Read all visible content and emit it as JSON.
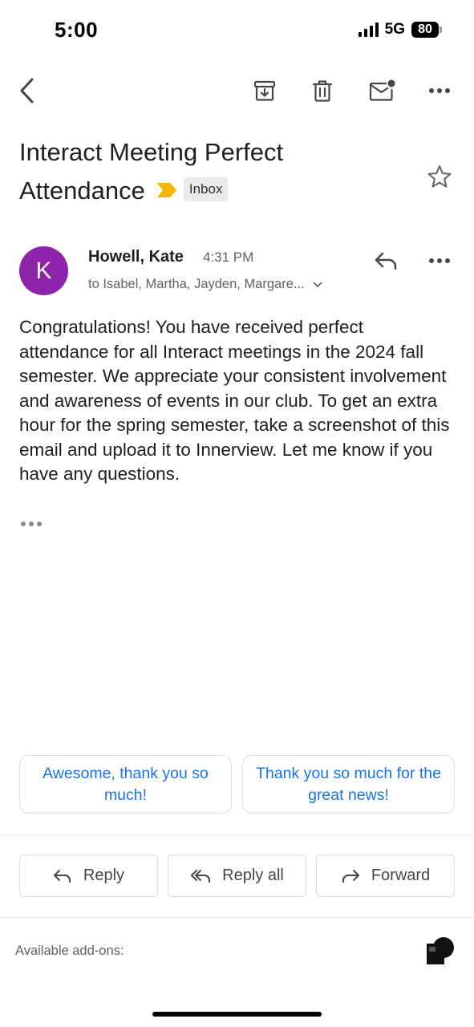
{
  "status_bar": {
    "time": "5:00",
    "network": "5G",
    "battery": "80"
  },
  "toolbar": {
    "icons": [
      "back-icon",
      "archive-icon",
      "trash-icon",
      "mark-unread-icon",
      "more-icon"
    ]
  },
  "email": {
    "subject": "Interact Meeting Perfect Attendance",
    "label": "Inbox",
    "importance_color": "#f4b400",
    "sender": {
      "initial": "K",
      "name": "Howell, Kate",
      "time": "4:31 PM",
      "recipients": "to Isabel, Martha, Jayden, Margare...",
      "avatar_color": "#8e24aa"
    },
    "body": "Congratulations! You have received perfect attendance for all Interact meetings in the 2024 fall semester. We appreciate your consistent involvement and awareness of events in our club. To get an extra hour for the spring semester, take a screenshot of this email and upload it to Innerview. Let me know if you have any questions."
  },
  "smart_replies": [
    "Awesome, thank you so much!",
    "Thank you so much for the great news!"
  ],
  "actions": {
    "reply": "Reply",
    "reply_all": "Reply all",
    "forward": "Forward"
  },
  "addons": {
    "label": "Available add-ons:"
  },
  "colors": {
    "accent": "#1a73e8",
    "text": "#1f1f1f",
    "secondary_text": "#5f6368"
  }
}
